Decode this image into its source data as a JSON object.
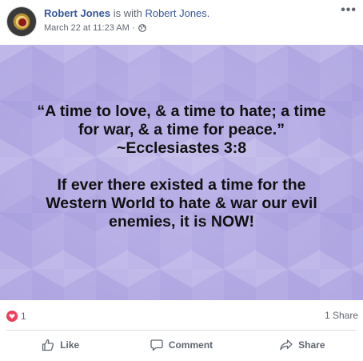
{
  "header": {
    "author_name": "Robert Jones",
    "with_text": "is with",
    "with_name": "Robert Jones.",
    "timestamp": "March 22 at 11:23 AM",
    "separator": "·",
    "privacy_icon": "globe-icon",
    "more_icon": "more-options-icon",
    "more_glyph": "•••"
  },
  "post_image": {
    "line1": "“A time to love, & a time to hate; a time",
    "line2": "for war, & a time for peace.”",
    "line3": "~Ecclesiastes 3:8",
    "line4": "If ever there existed a time for the",
    "line5": "Western World to hate & war our evil",
    "line6": "enemies, it is NOW!",
    "background_color": "#b7aee6"
  },
  "reactions": {
    "icon": "love-reaction-icon",
    "count": "1",
    "shares": "1 Share",
    "love_color": "#f33e58"
  },
  "actions": {
    "like_label": "Like",
    "comment_label": "Comment",
    "share_label": "Share"
  }
}
